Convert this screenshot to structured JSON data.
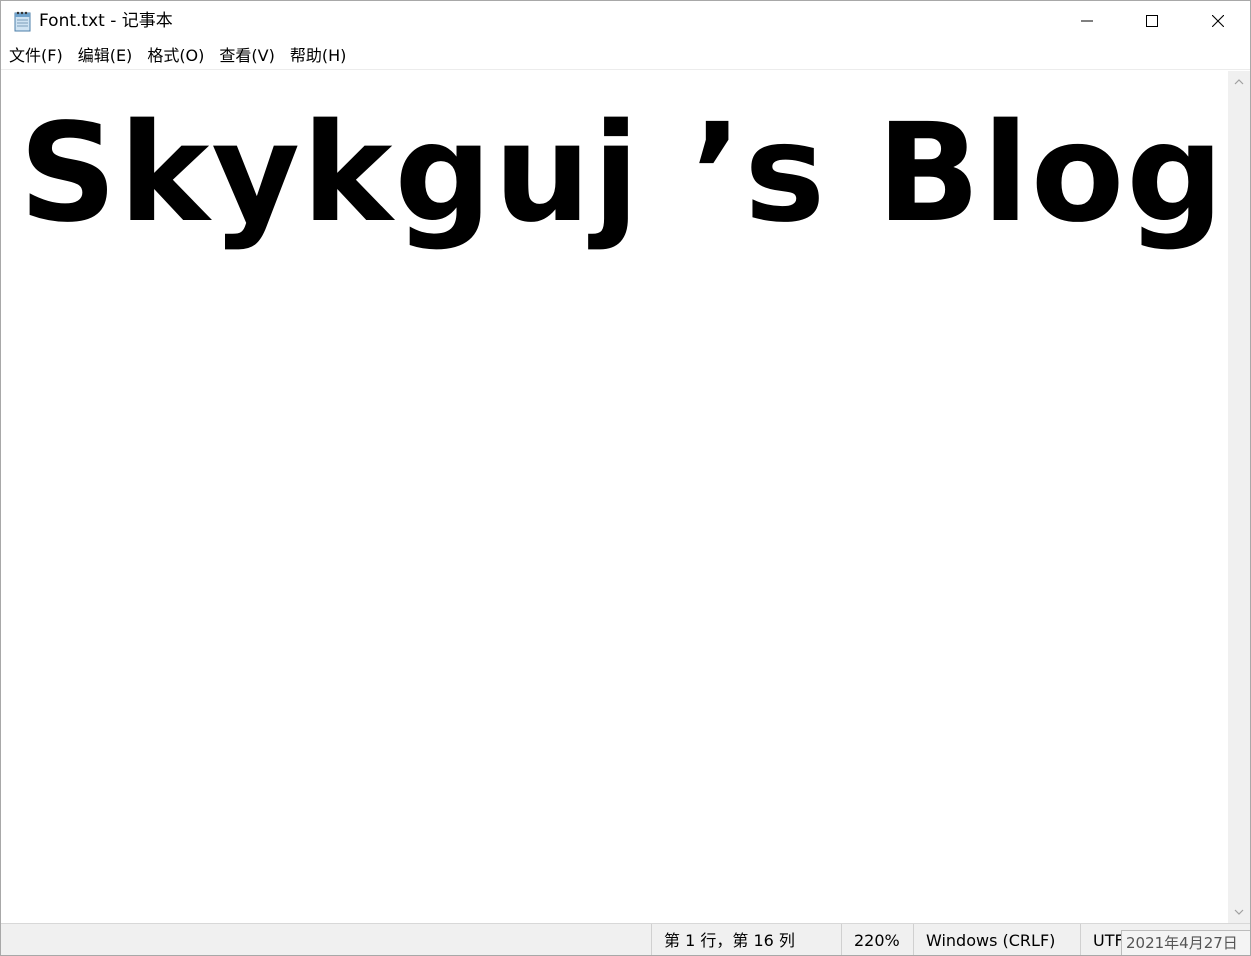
{
  "window": {
    "title": "Font.txt - 记事本"
  },
  "menu": {
    "items": [
      "文件(F)",
      "编辑(E)",
      "格式(O)",
      "查看(V)",
      "帮助(H)"
    ]
  },
  "editor": {
    "content": "Skykguj ’s Blog"
  },
  "status": {
    "position": "第 1 行，第 16 列",
    "zoom": "220%",
    "line_ending": "Windows (CRLF)",
    "encoding": "UTF-8"
  },
  "overlay": {
    "date": "2021年4月27日"
  },
  "icons": {
    "app": "notepad-icon",
    "minimize": "minimize-icon",
    "maximize": "maximize-icon",
    "close": "close-icon"
  }
}
